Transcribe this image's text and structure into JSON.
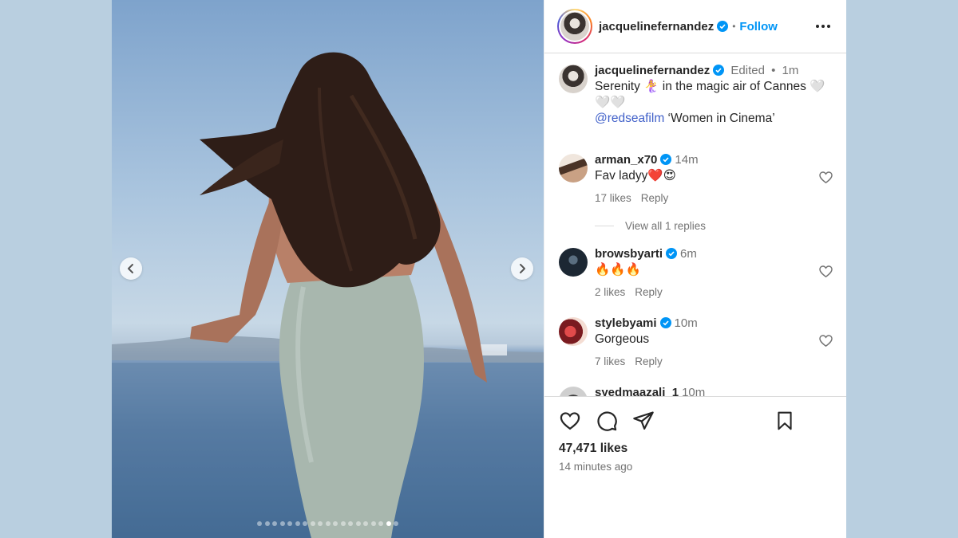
{
  "post": {
    "author": "jacquelinefernandez",
    "follow_label": "Follow",
    "separator": "•",
    "caption": {
      "username": "jacquelinefernandez",
      "edited": "Edited",
      "time": "1m",
      "text_line1": "Serenity 🧜‍♀️ in the magic air of Cannes 🤍🤍🤍",
      "mention": "@redseafilm",
      "text_line2_rest": " ‘Women in Cinema’"
    },
    "comments": [
      {
        "username": "arman_x70",
        "time": "14m",
        "text": "Fav ladyy❤️😍",
        "likes": "17 likes",
        "reply": "Reply"
      },
      {
        "username": "browsbyarti",
        "time": "6m",
        "text": "🔥🔥🔥",
        "likes": "2 likes",
        "reply": "Reply"
      },
      {
        "username": "stylebyami",
        "time": "10m",
        "text": "Gorgeous",
        "likes": "7 likes",
        "reply": "Reply"
      },
      {
        "username": "syedmaazali_1",
        "time": "10m"
      }
    ],
    "view_replies": "View all 1 replies",
    "likes_count": "47,471 likes",
    "posted_ago": "14 minutes ago",
    "carousel": {
      "total": 19,
      "active_index": 17
    },
    "colors": {
      "verified": "#0095f6",
      "follow": "#0095f6",
      "mention": "#4060c9"
    }
  }
}
